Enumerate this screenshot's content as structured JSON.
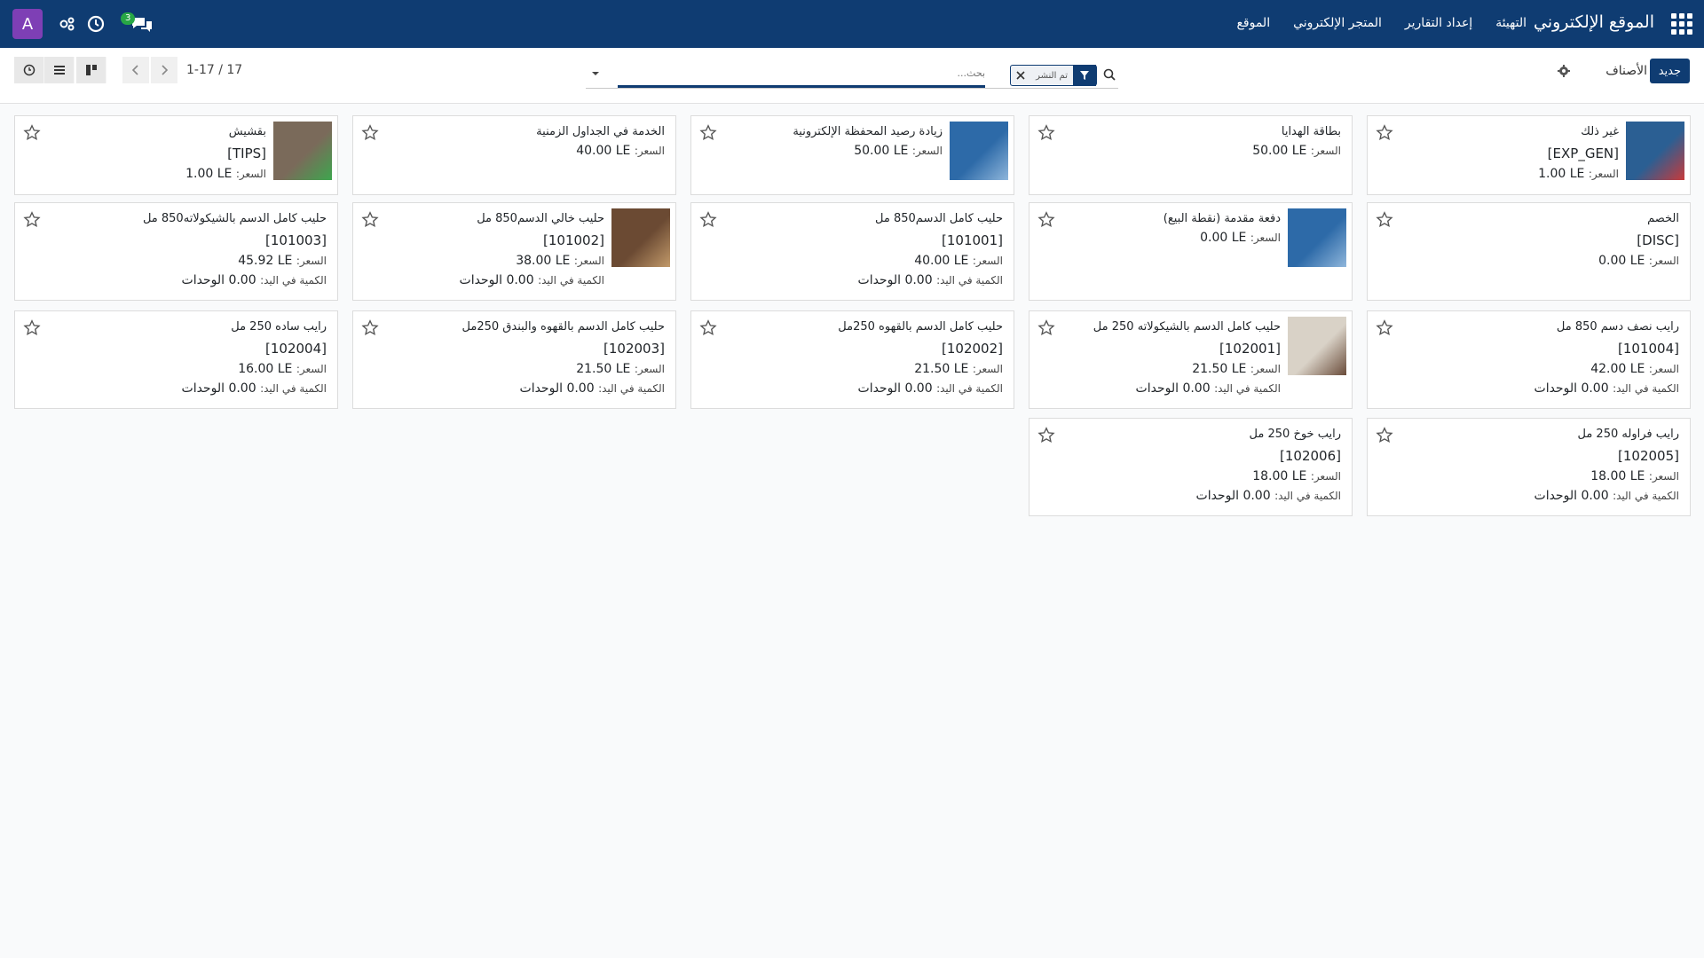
{
  "navbar": {
    "brand": "الموقع الإلكتروني",
    "menu": [
      "الموقع",
      "المتجر الإلكتروني",
      "إعداد التقارير",
      "التهيئة"
    ],
    "avatar_letter": "A",
    "messages_badge": "3",
    "colors": {
      "navbar": "#0f3c72",
      "avatar": "#7e3fb5",
      "badge": "#28a745"
    }
  },
  "control": {
    "new_label": "جديد",
    "breadcrumb": "الأصناف",
    "search_placeholder": "بحث...",
    "facet_label": "تم النشر",
    "pager": "1-17 / 17"
  },
  "products": [
    {
      "name": "غير ذلك",
      "code": "[EXP_GEN]",
      "price_label": "السعر:",
      "price": "1.00 LE",
      "qty_label": "",
      "qty": "",
      "image": "milk-promo"
    },
    {
      "name": "بطاقة الهدايا",
      "code": "",
      "price_label": "السعر:",
      "price": "50.00 LE",
      "qty_label": "",
      "qty": "",
      "image": ""
    },
    {
      "name": "زيادة رصيد المحفظة الإلكترونية",
      "code": "",
      "price_label": "السعر:",
      "price": "50.00 LE",
      "qty_label": "",
      "qty": "",
      "image": "milk-promo-blue"
    },
    {
      "name": "الخدمة في الجداول الزمنية",
      "code": "",
      "price_label": "السعر:",
      "price": "40.00 LE",
      "qty_label": "",
      "qty": "",
      "image": ""
    },
    {
      "name": "بقشيش",
      "code": "[TIPS]",
      "price_label": "السعر:",
      "price": "1.00 LE",
      "qty_label": "",
      "qty": "",
      "image": "bottles"
    },
    {
      "name": "الخصم",
      "code": "[DISC]",
      "price_label": "السعر:",
      "price": "0.00 LE",
      "qty_label": "",
      "qty": "",
      "image": ""
    },
    {
      "name": "دفعة مقدمة (نقطة البيع)",
      "code": "",
      "price_label": "السعر:",
      "price": "0.00 LE",
      "qty_label": "",
      "qty": "",
      "image": "milk-promo-blue"
    },
    {
      "name": "حليب كامل الدسم850 مل",
      "code": "[101001]",
      "price_label": "السعر:",
      "price": "40.00 LE",
      "qty_label": "الكمية في اليد:",
      "qty": "0.00 الوحدات",
      "image": ""
    },
    {
      "name": "حليب خالي الدسم850 مل",
      "code": "[101002]",
      "price_label": "السعر:",
      "price": "38.00 LE",
      "qty_label": "الكمية في اليد:",
      "qty": "0.00 الوحدات",
      "image": "breakfast"
    },
    {
      "name": "حليب كامل الدسم بالشيكولاته850 مل",
      "code": "[101003]",
      "price_label": "السعر:",
      "price": "45.92 LE",
      "qty_label": "الكمية في اليد:",
      "qty": "0.00 الوحدات",
      "image": ""
    },
    {
      "name": "رايب نصف دسم 850 مل",
      "code": "[101004]",
      "price_label": "السعر:",
      "price": "42.00 LE",
      "qty_label": "الكمية في اليد:",
      "qty": "0.00 الوحدات",
      "image": ""
    },
    {
      "name": "حليب كامل الدسم بالشيكولاته 250 مل",
      "code": "[102001]",
      "price_label": "السعر:",
      "price": "21.50 LE",
      "qty_label": "الكمية في اليد:",
      "qty": "0.00 الوحدات",
      "image": "chocolate"
    },
    {
      "name": "حليب كامل الدسم بالقهوه 250مل",
      "code": "[102002]",
      "price_label": "السعر:",
      "price": "21.50 LE",
      "qty_label": "الكمية في اليد:",
      "qty": "0.00 الوحدات",
      "image": ""
    },
    {
      "name": "حليب كامل الدسم بالقهوه والبندق 250مل",
      "code": "[102003]",
      "price_label": "السعر:",
      "price": "21.50 LE",
      "qty_label": "الكمية في اليد:",
      "qty": "0.00 الوحدات",
      "image": ""
    },
    {
      "name": "رايب ساده 250 مل",
      "code": "[102004]",
      "price_label": "السعر:",
      "price": "16.00 LE",
      "qty_label": "الكمية في اليد:",
      "qty": "0.00 الوحدات",
      "image": ""
    },
    {
      "name": "رايب فراوله 250 مل",
      "code": "[102005]",
      "price_label": "السعر:",
      "price": "18.00 LE",
      "qty_label": "الكمية في اليد:",
      "qty": "0.00 الوحدات",
      "image": ""
    },
    {
      "name": "رايب خوخ 250 مل",
      "code": "[102006]",
      "price_label": "السعر:",
      "price": "18.00 LE",
      "qty_label": "الكمية في اليد:",
      "qty": "0.00 الوحدات",
      "image": ""
    }
  ]
}
